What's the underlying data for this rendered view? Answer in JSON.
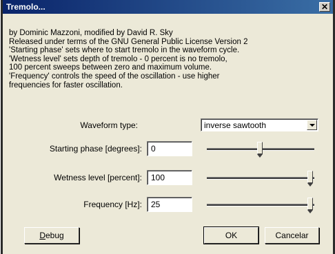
{
  "window": {
    "title": "Tremolo...",
    "close_glyph": "✕"
  },
  "description": {
    "lines": [
      "by Dominic Mazzoni, modified by David R. Sky",
      "Released under terms of the GNU General Public License Version 2",
      "'Starting phase' sets where to start tremolo in the waveform cycle.",
      "'Wetness level' sets depth of tremolo - 0 percent is no tremolo,",
      "100 percent sweeps between zero and maximum volume.",
      "'Frequency' controls the speed of the oscillation - use higher",
      "frequencies for faster oscillation."
    ]
  },
  "controls": {
    "waveform": {
      "label": "Waveform type:",
      "value": "inverse sawtooth"
    },
    "phase": {
      "label": "Starting phase [degrees]:",
      "value": "0",
      "slider_fraction": 0.5
    },
    "wetness": {
      "label": "Wetness level [percent]:",
      "value": "100",
      "slider_fraction": 1.0
    },
    "frequency": {
      "label": "Frequency [Hz]:",
      "value": "25",
      "slider_fraction": 1.0
    }
  },
  "buttons": {
    "debug_first": "D",
    "debug_rest": "ebug",
    "ok": "OK",
    "cancel": "Cancelar"
  }
}
